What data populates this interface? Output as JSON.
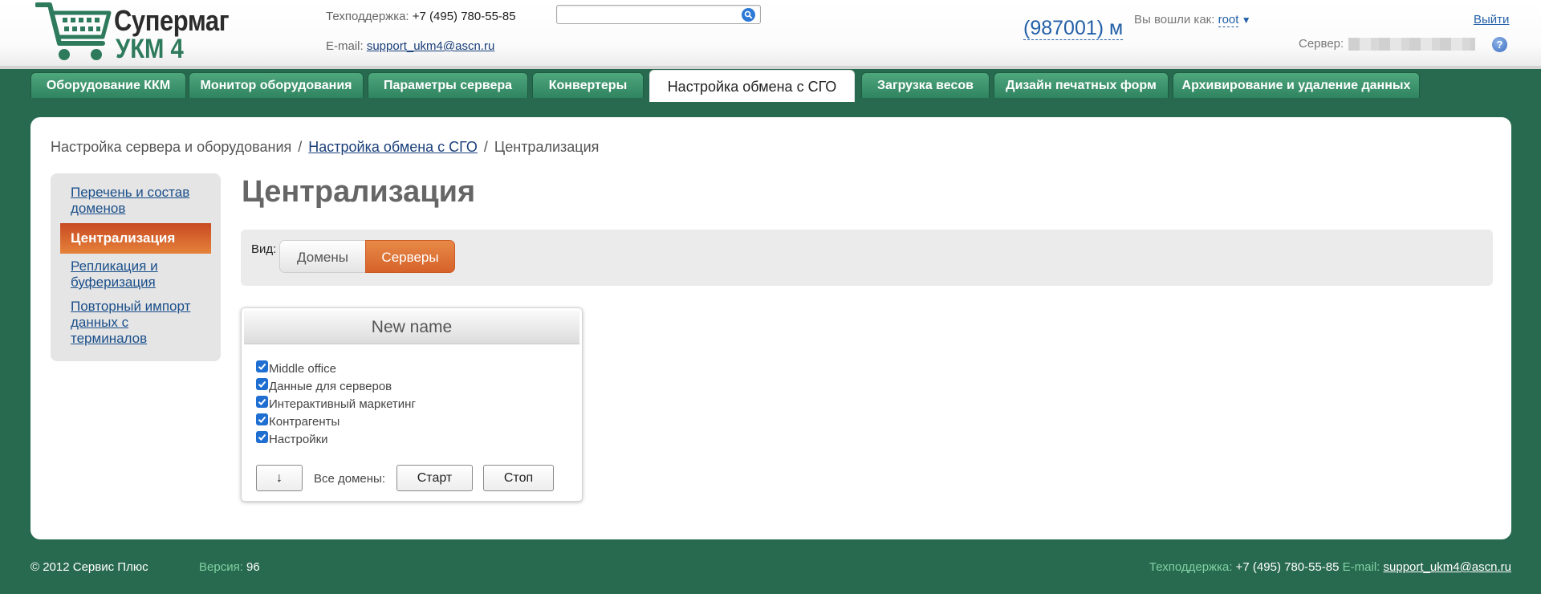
{
  "header": {
    "logo_line1": "Супермаг",
    "logo_line2": "УКМ 4",
    "support_label": "Техподдержка:",
    "support_phone": "+7 (495) 780-55-85",
    "email_label": "E-mail:",
    "email": "support_ukm4@ascn.ru",
    "search_placeholder": "",
    "counter": "(987001) м",
    "login_label": "Вы вошли как:",
    "user": "root",
    "logout": "Выйти",
    "server_label": "Сервер:"
  },
  "tabs": [
    {
      "label": "Оборудование ККМ"
    },
    {
      "label": "Монитор оборудования"
    },
    {
      "label": "Параметры сервера"
    },
    {
      "label": "Конвертеры"
    },
    {
      "label": "Настройка обмена с СГО"
    },
    {
      "label": "Загрузка весов"
    },
    {
      "label": "Дизайн печатных форм"
    },
    {
      "label": "Архивирование и удаление данных"
    }
  ],
  "breadcrumb": {
    "root": "Настройка сервера и оборудования",
    "parent": "Настройка обмена с СГО",
    "current": "Централизация",
    "separator": "/"
  },
  "sidenav": {
    "item1": "Перечень и состав доменов",
    "active": "Централизация",
    "item3": "Репликация и буферизация",
    "item4": "Повторный импорт данных с терминалов"
  },
  "main": {
    "title": "Централизация",
    "view_label": "Вид:",
    "view_domains": "Домены",
    "view_servers": "Серверы"
  },
  "card": {
    "title": "New name",
    "checks": [
      {
        "label": "Middle office",
        "checked": true
      },
      {
        "label": "Данные для серверов",
        "checked": true
      },
      {
        "label": "Интерактивный маркетинг",
        "checked": true
      },
      {
        "label": "Контрагенты",
        "checked": true
      },
      {
        "label": "Настройки",
        "checked": true
      }
    ],
    "down_button": "↓",
    "all_domains_label": "Все домены:",
    "start_button": "Старт",
    "stop_button": "Стоп"
  },
  "footer": {
    "copyright": "© 2012 Сервис Плюс",
    "version_label": "Версия:",
    "version": "96",
    "support_label": "Техподдержка:",
    "support_phone": "+7 (495) 780-55-85",
    "email_label": "E-mail:",
    "email": "support_ukm4@ascn.ru"
  },
  "colors": {
    "brand_green": "#286a4f",
    "tab_green": "#3a9169",
    "active_orange": "#d9652c",
    "link_blue": "#1a4f8a"
  }
}
